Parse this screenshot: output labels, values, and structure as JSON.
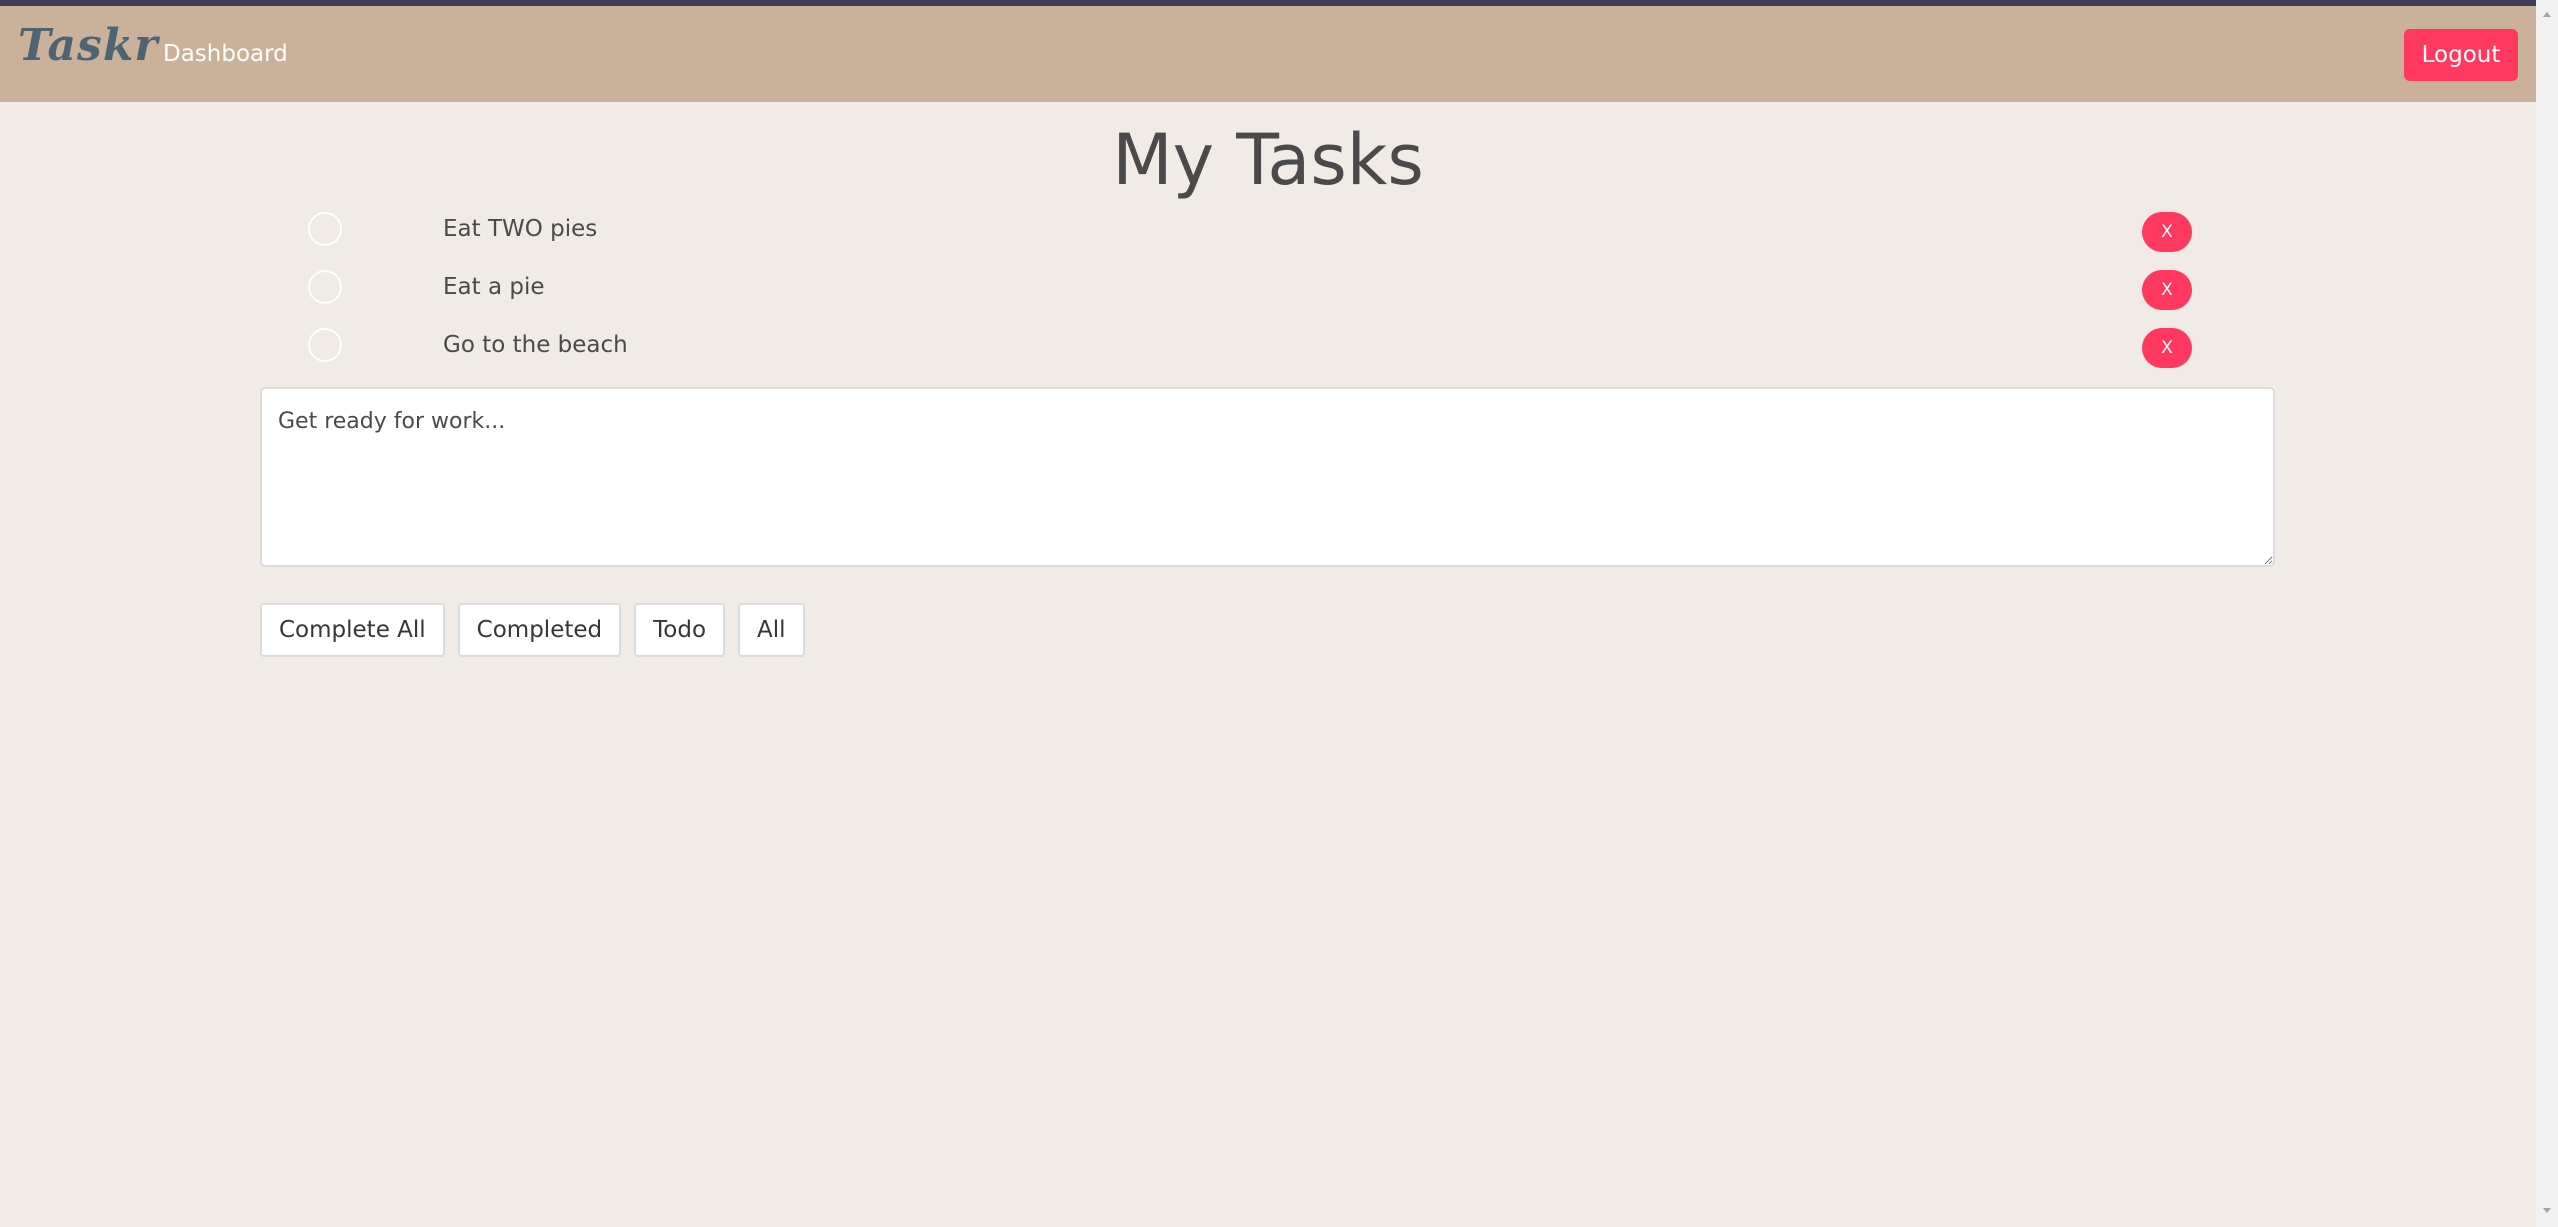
{
  "navbar": {
    "brand": "Taskr",
    "dashboard_link": "Dashboard",
    "logout_label": "Logout"
  },
  "main": {
    "title": "My Tasks",
    "tasks": [
      {
        "text": "Eat TWO pies",
        "delete_label": "X"
      },
      {
        "text": "Eat a pie",
        "delete_label": "X"
      },
      {
        "text": "Go to the beach",
        "delete_label": "X"
      }
    ],
    "new_task_placeholder": "Get ready for work...",
    "filters": {
      "complete_all": "Complete All",
      "completed": "Completed",
      "todo": "Todo",
      "all": "All"
    }
  },
  "colors": {
    "navbar_bg": "#c9b299",
    "page_bg": "#f0ebe4",
    "accent_danger": "#ff3860",
    "brand_text": "#4f6473"
  },
  "icons": {
    "task_checkbox": "circle-outline-icon",
    "scroll_up": "triangle-up-icon",
    "scroll_down": "triangle-down-icon"
  }
}
